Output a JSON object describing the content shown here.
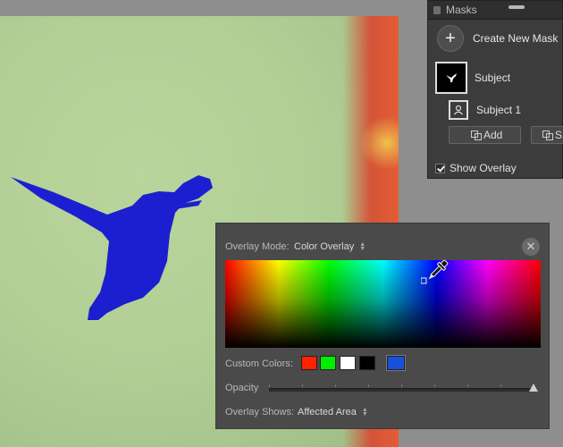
{
  "masks_panel": {
    "title": "Masks",
    "create_new_mask": "Create New Mask",
    "plus_icon": "+",
    "mask_name": "Subject",
    "submask_name": "Subject 1",
    "add_label": "Add",
    "subtract_label": "S",
    "show_overlay_label": "Show Overlay",
    "show_overlay_checked": true
  },
  "overlay_panel": {
    "mode_label": "Overlay Mode:",
    "mode_value": "Color Overlay",
    "custom_colors_label": "Custom Colors:",
    "custom_colors": [
      "#ff2200",
      "#00ee00",
      "#ffffff",
      "#000000"
    ],
    "selected_color": "#1a4fd9",
    "opacity_label": "Opacity",
    "opacity_value": 1.0,
    "shows_label": "Overlay Shows:",
    "shows_value": "Affected Area",
    "close_icon": "close-icon",
    "picker_icon": "eyedropper-icon"
  },
  "colors": {
    "mask_overlay": "#1c1fcf",
    "panel_bg": "#4a4a4a"
  }
}
